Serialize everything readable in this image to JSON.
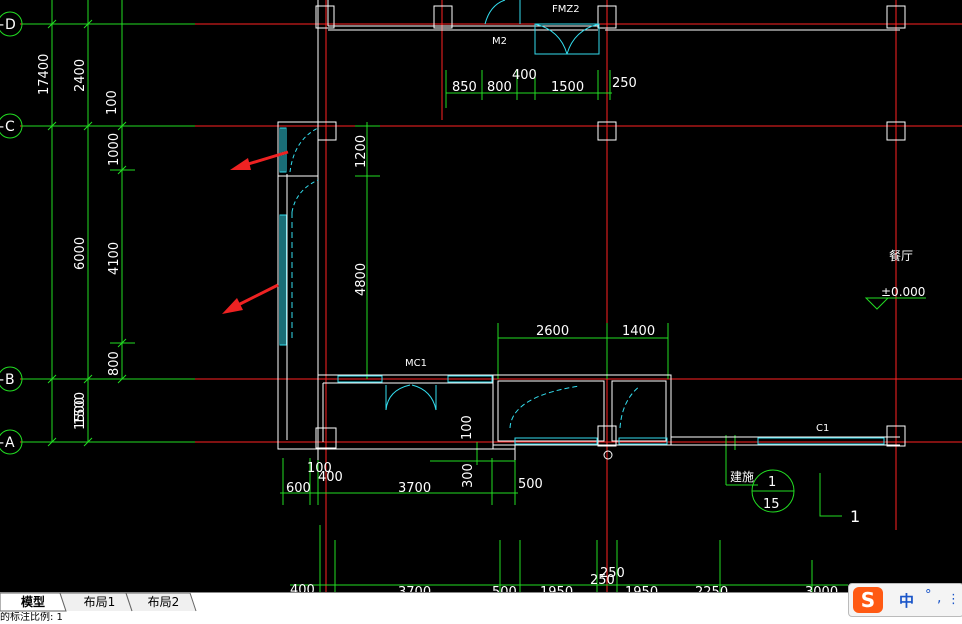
{
  "drawing": {
    "axis_labels": [
      "D",
      "C",
      "B",
      "A"
    ],
    "left_dims_outer": [
      "17400",
      "6000",
      "1500"
    ],
    "left_dims_mid": [
      "2400",
      "100",
      "1000",
      "4100",
      "800",
      "1500"
    ],
    "top_dims": [
      "850",
      "800",
      "400",
      "1500",
      "250"
    ],
    "door_labels": {
      "fmz2": "FMZ2",
      "m2": "M2",
      "mc1": "MC1",
      "c1": "C1"
    },
    "inner_dims": [
      "1200",
      "4800",
      "2600",
      "1400",
      "100",
      "300"
    ],
    "bottom_dims": [
      "100",
      "400",
      "600",
      "3700",
      "500"
    ],
    "bottom_row_dims": [
      "400",
      "3700",
      "500",
      "1950",
      "250",
      "250",
      "1950",
      "2250",
      "3000"
    ],
    "room_label": "餐厅",
    "elevation": "±0.000",
    "detail_ref": {
      "text": "建施",
      "top": "1",
      "bottom": "15"
    },
    "section_mark": "1"
  },
  "tabs": {
    "model": "模型",
    "layout1": "布局1",
    "layout2": "布局2"
  },
  "cmdline": {
    "text": "的标注比例: 1"
  },
  "ime": {
    "logo": "S",
    "lang": "中",
    "moon": "°",
    "punct": ",",
    "more": "⋮"
  },
  "colors": {
    "axis_line": "#ff2222",
    "dim_line": "#22dd22",
    "wall": "#ffffff",
    "window": "#33ddee",
    "arrow": "#ee2222",
    "text": "#ffffff",
    "background": "#000000"
  }
}
